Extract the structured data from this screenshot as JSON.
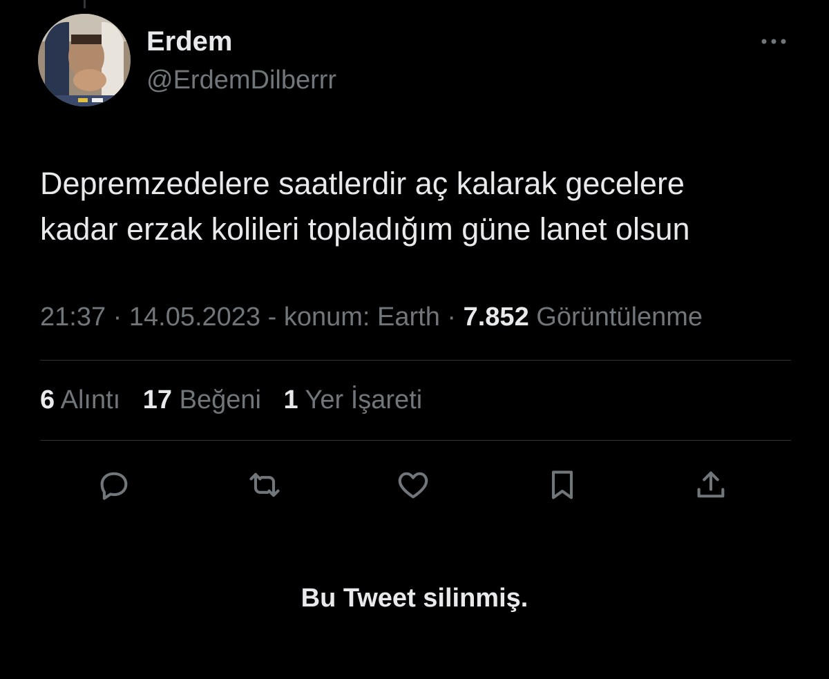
{
  "author": {
    "name": "Erdem",
    "handle": "@ErdemDilberrr"
  },
  "tweet": {
    "text_line1": "Depremzedelere saatlerdir aç kalarak gecelere",
    "text_line2": "kadar erzak kolileri topladığım güne lanet olsun"
  },
  "meta": {
    "time": "21:37",
    "sep1": " · ",
    "date": "14.05.2023",
    "location": " - konum: Earth",
    "sep2": " · ",
    "views_count": "7.852",
    "views_label": " Görüntülenme"
  },
  "stats": [
    {
      "count": "6",
      "label": " Alıntı"
    },
    {
      "count": "17",
      "label": " Beğeni"
    },
    {
      "count": "1",
      "label": " Yer İşareti"
    }
  ],
  "icons": {
    "more": "more-horizontal-icon",
    "reply": "reply-icon",
    "retweet": "retweet-icon",
    "like": "heart-icon",
    "bookmark": "bookmark-icon",
    "share": "share-icon"
  },
  "colors": {
    "background": "#000000",
    "text_primary": "#e7e9ea",
    "text_secondary": "#71767b",
    "divider": "#2f3336"
  },
  "footer": {
    "deleted_note": "Bu Tweet silinmiş."
  }
}
